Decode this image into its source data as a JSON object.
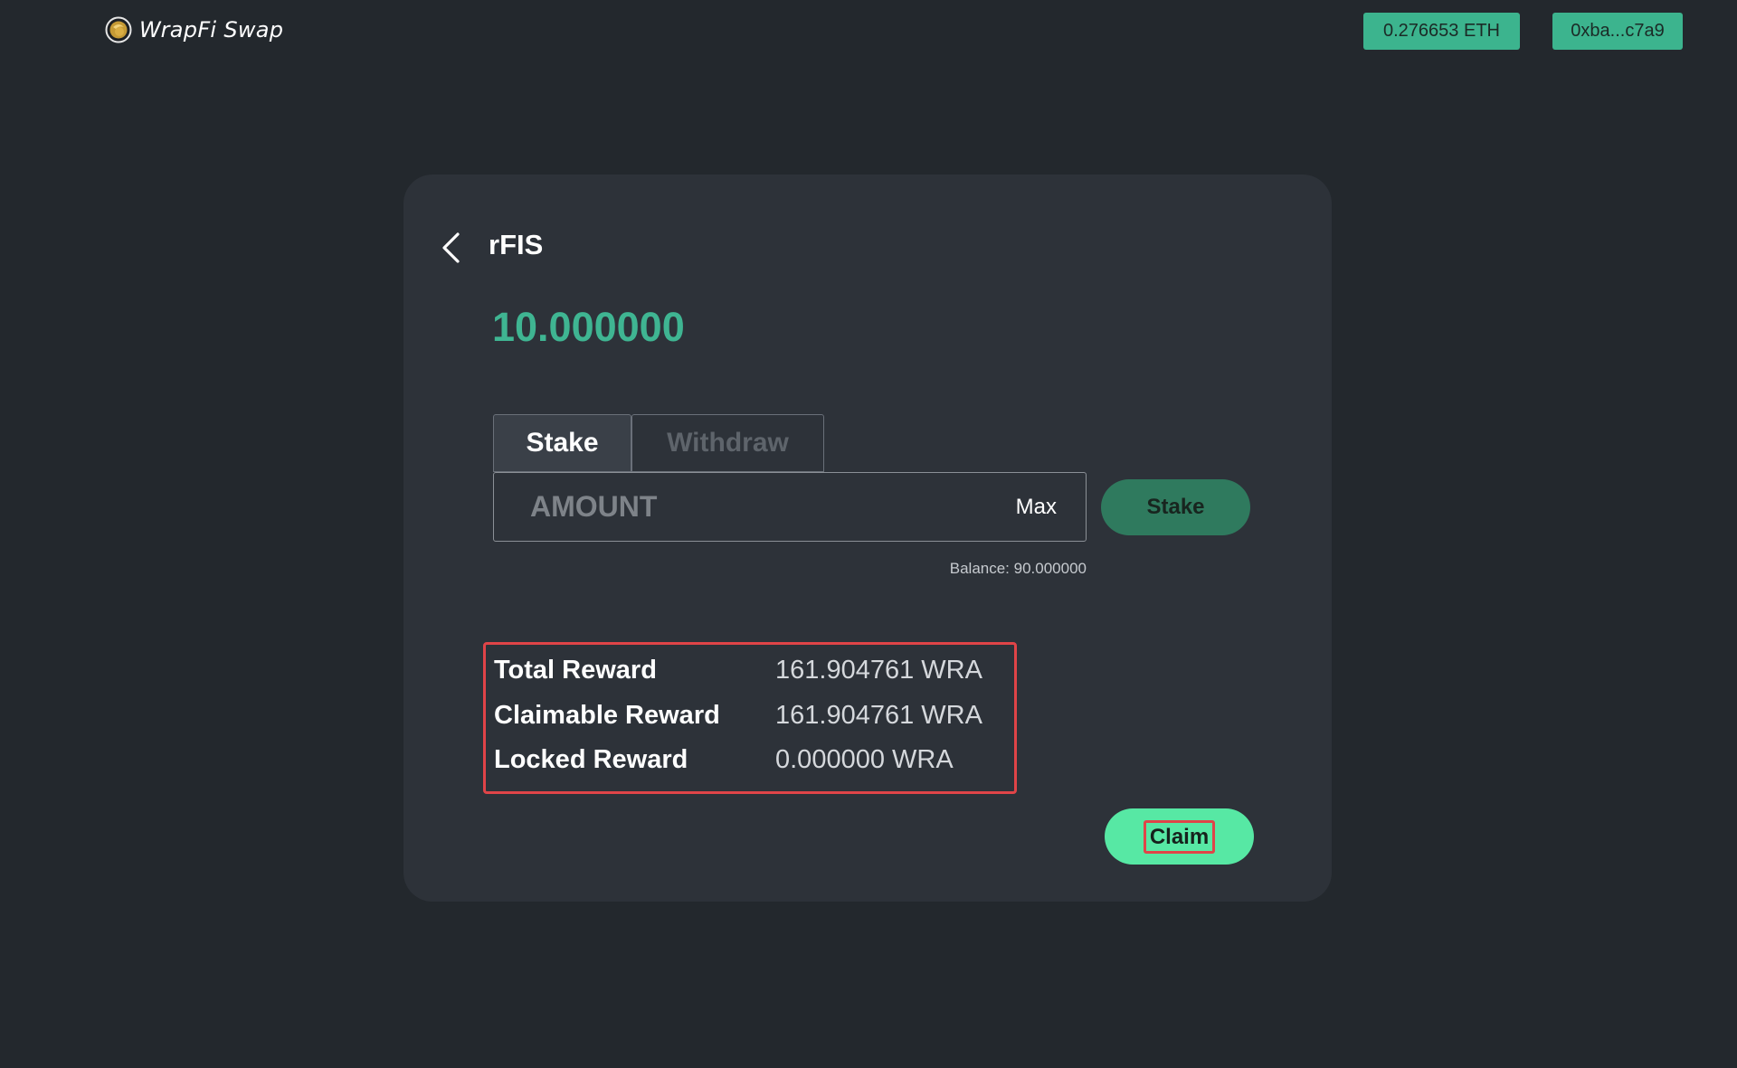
{
  "header": {
    "brand_name": "WrapFi Swap",
    "eth_balance": "0.276653 ETH",
    "wallet_address": "0xba...c7a9"
  },
  "pool": {
    "token_name": "rFIS",
    "staked_amount": "10.000000"
  },
  "tabs": [
    {
      "label": "Stake",
      "active": true
    },
    {
      "label": "Withdraw",
      "active": false
    }
  ],
  "amount_input": {
    "placeholder": "AMOUNT",
    "value": "",
    "max_label": "Max"
  },
  "stake_button_label": "Stake",
  "balance_text": "Balance: 90.000000",
  "rewards": [
    {
      "label": "Total Reward",
      "value": "161.904761 WRA"
    },
    {
      "label": "Claimable Reward",
      "value": "161.904761 WRA"
    },
    {
      "label": "Locked Reward",
      "value": "0.000000 WRA"
    }
  ],
  "claim_button_label": "Claim",
  "colors": {
    "background": "#23282d",
    "card": "#2d3239",
    "accent": "#3cb48e",
    "amount_green": "#3fb592",
    "claim_green": "#57e8a4",
    "highlight_red": "#e04448"
  },
  "icons": {
    "brand_logo": "coin-logo-icon",
    "back": "chevron-left-icon"
  }
}
